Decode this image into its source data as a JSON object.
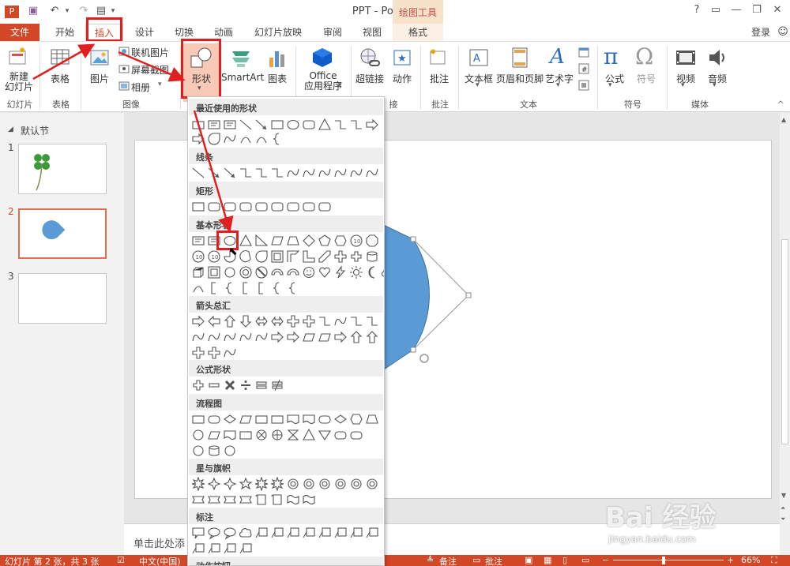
{
  "app": {
    "title": "PPT - PowerPoint",
    "context_tab_group": "绘图工具",
    "login": "登录"
  },
  "tabs": [
    "文件",
    "开始",
    "插入",
    "设计",
    "切换",
    "动画",
    "幻灯片放映",
    "审阅",
    "视图",
    "格式"
  ],
  "ribbon": {
    "new_slide": "新建\n幻灯片",
    "table": "表格",
    "image": "图片",
    "online_image": "联机图片",
    "screenshot": "屏幕截图",
    "album": "相册",
    "shapes": "形状",
    "smartart": "SmartArt",
    "chart": "图表",
    "office_apps": "Office\n应用程序",
    "hyperlink": "超链接",
    "action": "动作",
    "comment": "批注",
    "textbox": "文本框",
    "header_footer": "页眉和页脚",
    "wordart": "艺术字",
    "equation": "公式",
    "symbol": "符号",
    "video": "视频",
    "audio": "音频",
    "groups": [
      "幻灯片",
      "表格",
      "图像",
      "接",
      "批注",
      "文本",
      "符号",
      "媒体"
    ]
  },
  "sidebar": {
    "section": "默认节",
    "slides": [
      "1",
      "2",
      "3"
    ]
  },
  "dropdown": {
    "categories": [
      "最近使用的形状",
      "线条",
      "矩形",
      "基本形状",
      "箭头总汇",
      "公式形状",
      "流程图",
      "星与旗帜",
      "标注",
      "动作按钮"
    ]
  },
  "notes_placeholder": "单击此处添",
  "status": {
    "slide_info": "幻灯片 第 2 张，共 3 张",
    "language": "中文(中国)",
    "notes": "备注",
    "comments": "批注",
    "zoom": "66%"
  },
  "watermark": {
    "brand": "Bai 经验",
    "url": "jingyan.baidu.com"
  }
}
